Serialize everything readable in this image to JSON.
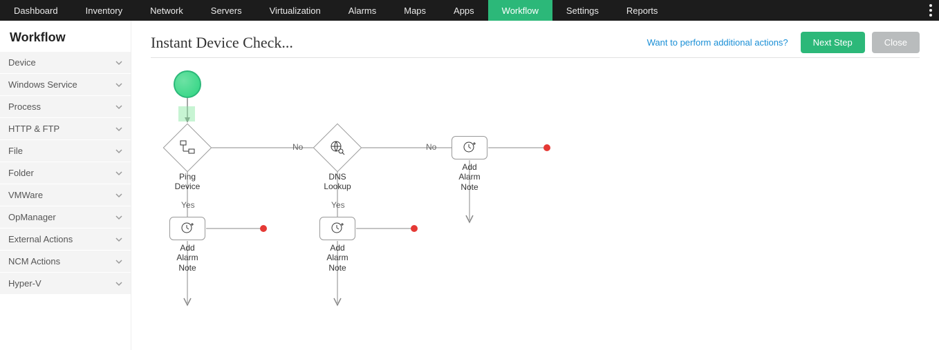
{
  "nav": {
    "items": [
      {
        "label": "Dashboard",
        "active": false
      },
      {
        "label": "Inventory",
        "active": false
      },
      {
        "label": "Network",
        "active": false
      },
      {
        "label": "Servers",
        "active": false
      },
      {
        "label": "Virtualization",
        "active": false
      },
      {
        "label": "Alarms",
        "active": false
      },
      {
        "label": "Maps",
        "active": false
      },
      {
        "label": "Apps",
        "active": false
      },
      {
        "label": "Workflow",
        "active": true
      },
      {
        "label": "Settings",
        "active": false
      },
      {
        "label": "Reports",
        "active": false
      }
    ]
  },
  "sidebar": {
    "title": "Workflow",
    "items": [
      {
        "label": "Device"
      },
      {
        "label": "Windows Service"
      },
      {
        "label": "Process"
      },
      {
        "label": "HTTP & FTP"
      },
      {
        "label": "File"
      },
      {
        "label": "Folder"
      },
      {
        "label": "VMWare"
      },
      {
        "label": "OpManager"
      },
      {
        "label": "External Actions"
      },
      {
        "label": "NCM Actions"
      },
      {
        "label": "Hyper-V"
      }
    ]
  },
  "main": {
    "title": "Instant Device Check...",
    "help_link": "Want to perform additional actions?",
    "next_step_label": "Next Step",
    "close_label": "Close"
  },
  "flow": {
    "nodes": {
      "ping": {
        "label_line1": "Ping",
        "label_line2": "Device"
      },
      "dns": {
        "label_line1": "DNS",
        "label_line2": "Lookup"
      },
      "alarm1": {
        "label_line1": "Add",
        "label_line2": "Alarm",
        "label_line3": "Note"
      },
      "alarm2": {
        "label_line1": "Add",
        "label_line2": "Alarm",
        "label_line3": "Note"
      },
      "alarm3": {
        "label_line1": "Add",
        "label_line2": "Alarm",
        "label_line3": "Note"
      }
    },
    "edge_labels": {
      "no1": "No",
      "no2": "No",
      "yes1": "Yes",
      "yes2": "Yes"
    }
  }
}
